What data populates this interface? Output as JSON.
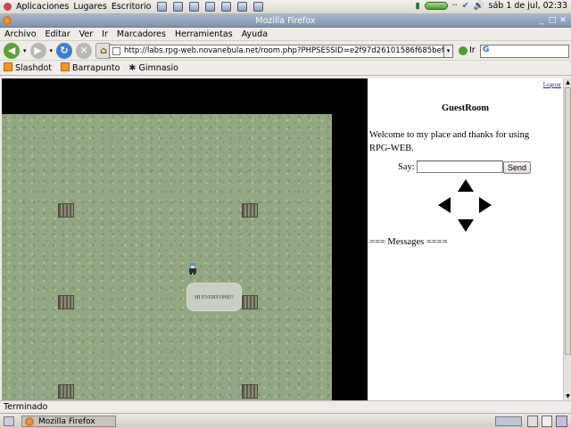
{
  "panel": {
    "apps_menu": "Aplicaciones",
    "places_menu": "Lugares",
    "desktop_menu": "Escritorio",
    "launchers": [
      "terminal-icon",
      "editor-icon",
      "network-icon",
      "tools-icon",
      "media-icon",
      "settings-icon",
      "help-icon"
    ],
    "tray_dots": "··",
    "clock": "sáb  1 de jul, 02:33"
  },
  "window": {
    "title": "Mozilla Firefox",
    "menu": [
      "Archivo",
      "Editar",
      "Ver",
      "Ir",
      "Marcadores",
      "Herramientas",
      "Ayuda"
    ],
    "url": "http://labs.rpg-web.novanebula.net/room.php?PHPSESSID=e2f97d26101586f685befab43bf97083",
    "go_label": "Ir",
    "search_engine": "G"
  },
  "bookmarks": [
    {
      "label": "Slashdot",
      "icon": "rss-icon"
    },
    {
      "label": "Barrapunto",
      "icon": "rss-icon"
    },
    {
      "label": "Gimnasio",
      "icon": "gear-icon"
    }
  ],
  "page": {
    "logout": "Logout",
    "room_title": "GuestRoom",
    "welcome": "Welcome to my place and thanks for using RPG-WEB.",
    "say_label": "Say:",
    "say_value": "",
    "send_label": "Send",
    "messages_header": "=== Messages ====",
    "speech_bubble": "HI EVERYONE!!"
  },
  "status": "Terminado",
  "taskbar": {
    "window_button": "Mozilla Firefox"
  },
  "colors": {
    "titlebar": "#8a9db5",
    "grass": "#93a882",
    "link": "#1a1ad0"
  }
}
